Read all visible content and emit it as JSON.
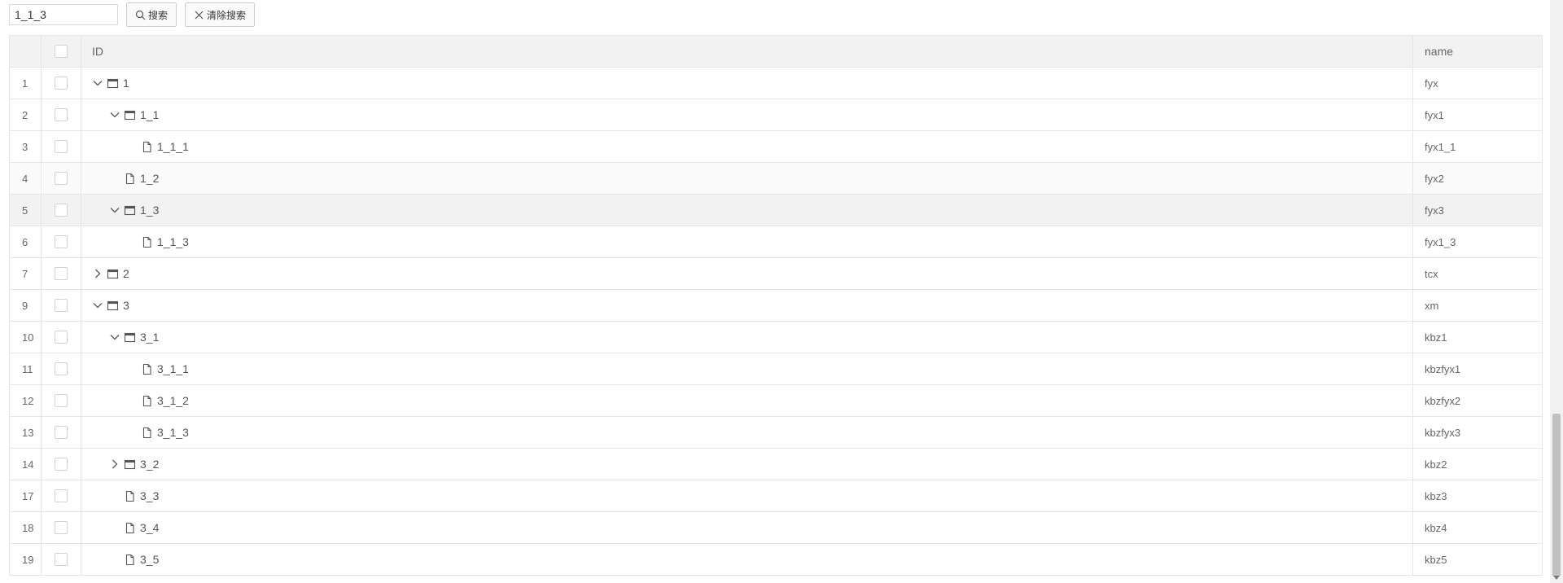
{
  "search": {
    "value": "1_1_3"
  },
  "buttons": {
    "search_label": "搜索",
    "clear_label": "清除搜索"
  },
  "columns": {
    "id": "ID",
    "name": "name"
  },
  "rows": [
    {
      "num": "1",
      "id": "1",
      "name": "fyx",
      "depth": 0,
      "type": "folder",
      "state": "expanded"
    },
    {
      "num": "2",
      "id": "1_1",
      "name": "fyx1",
      "depth": 1,
      "type": "folder",
      "state": "expanded"
    },
    {
      "num": "3",
      "id": "1_1_1",
      "name": "fyx1_1",
      "depth": 2,
      "type": "file"
    },
    {
      "num": "4",
      "id": "1_2",
      "name": "fyx2",
      "depth": 1,
      "type": "file"
    },
    {
      "num": "5",
      "id": "1_3",
      "name": "fyx3",
      "depth": 1,
      "type": "folder",
      "state": "expanded"
    },
    {
      "num": "6",
      "id": "1_1_3",
      "name": "fyx1_3",
      "depth": 2,
      "type": "file"
    },
    {
      "num": "7",
      "id": "2",
      "name": "tcx",
      "depth": 0,
      "type": "folder",
      "state": "collapsed"
    },
    {
      "num": "9",
      "id": "3",
      "name": "xm",
      "depth": 0,
      "type": "folder",
      "state": "expanded"
    },
    {
      "num": "10",
      "id": "3_1",
      "name": "kbz1",
      "depth": 1,
      "type": "folder",
      "state": "expanded"
    },
    {
      "num": "11",
      "id": "3_1_1",
      "name": "kbzfyx1",
      "depth": 2,
      "type": "file"
    },
    {
      "num": "12",
      "id": "3_1_2",
      "name": "kbzfyx2",
      "depth": 2,
      "type": "file"
    },
    {
      "num": "13",
      "id": "3_1_3",
      "name": "kbzfyx3",
      "depth": 2,
      "type": "file"
    },
    {
      "num": "14",
      "id": "3_2",
      "name": "kbz2",
      "depth": 1,
      "type": "folder",
      "state": "collapsed"
    },
    {
      "num": "17",
      "id": "3_3",
      "name": "kbz3",
      "depth": 1,
      "type": "file"
    },
    {
      "num": "18",
      "id": "3_4",
      "name": "kbz4",
      "depth": 1,
      "type": "file"
    },
    {
      "num": "19",
      "id": "3_5",
      "name": "kbz5",
      "depth": 1,
      "type": "file"
    }
  ],
  "highlight": {
    "alt_row": "4",
    "hover_row": "5"
  }
}
